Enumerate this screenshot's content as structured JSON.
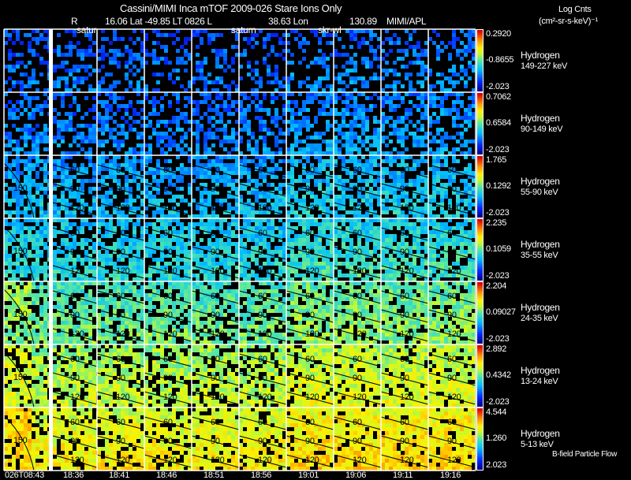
{
  "header": {
    "title": "Cassini/MIMI Inca mTOF  2009-026   Stare   Ions Only",
    "r_label": "R",
    "position_line": "16.06 Lat -49.85 LT 0826 L",
    "l_value": "38.63 Lon",
    "lon_value": "130.89",
    "credit": "MIMI/APL",
    "units_line1": "Log Cnts",
    "units_line2": "(cm²-sr-s-keV)⁻¹"
  },
  "markers": [
    "satur",
    "saturn",
    "skr-wl"
  ],
  "footer": {
    "flow_label": "B-field Particle Flow"
  },
  "chart_data": {
    "type": "heatmap",
    "title": "Cassini/MIMI Inca mTOF  2009-026   Stare   Ions Only",
    "x_tick_labels": [
      "026T08:43",
      "18:36",
      "18:41",
      "18:46",
      "18:51",
      "18:56",
      "19:01",
      "19:06",
      "19:11",
      "19:16"
    ],
    "contour_labels": [
      "60",
      "90",
      "120",
      "150"
    ],
    "colorbar_units": "Log Cnts (cm²-sr-s-keV)⁻¹",
    "rows": [
      {
        "species": "Hydrogen",
        "energy": "149-227 keV",
        "cmax": "0.2920",
        "cmid": "-0.8655",
        "cmin": "-2.023",
        "level": 0.22,
        "fill": 0.4,
        "contours": false
      },
      {
        "species": "Hydrogen",
        "energy": "90-149 keV",
        "cmax": "0.7062",
        "cmid": "0.6584",
        "cmin": "-2.023",
        "level": 0.25,
        "fill": 0.55,
        "contours": false
      },
      {
        "species": "Hydrogen",
        "energy": "55-90 keV",
        "cmax": "1.765",
        "cmid": "0.1292",
        "cmin": "-2.023",
        "level": 0.33,
        "fill": 0.65,
        "contours": true
      },
      {
        "species": "Hydrogen",
        "energy": "35-55 keV",
        "cmax": "2.235",
        "cmid": "0.1059",
        "cmin": "-2.023",
        "level": 0.4,
        "fill": 0.75,
        "contours": true
      },
      {
        "species": "Hydrogen",
        "energy": "24-35 keV",
        "cmax": "2.204",
        "cmid": "0.09027",
        "cmin": "-2.023",
        "level": 0.5,
        "fill": 0.78,
        "contours": true
      },
      {
        "species": "Hydrogen",
        "energy": "13-24 keV",
        "cmax": "2.892",
        "cmid": "0.4342",
        "cmin": "-2.023",
        "level": 0.6,
        "fill": 0.82,
        "contours": true
      },
      {
        "species": "Hydrogen",
        "energy": "5-13 keV",
        "cmax": "4.544",
        "cmid": "1.260",
        "cmin": "2.023",
        "level": 0.68,
        "fill": 0.85,
        "contours": true
      }
    ]
  }
}
